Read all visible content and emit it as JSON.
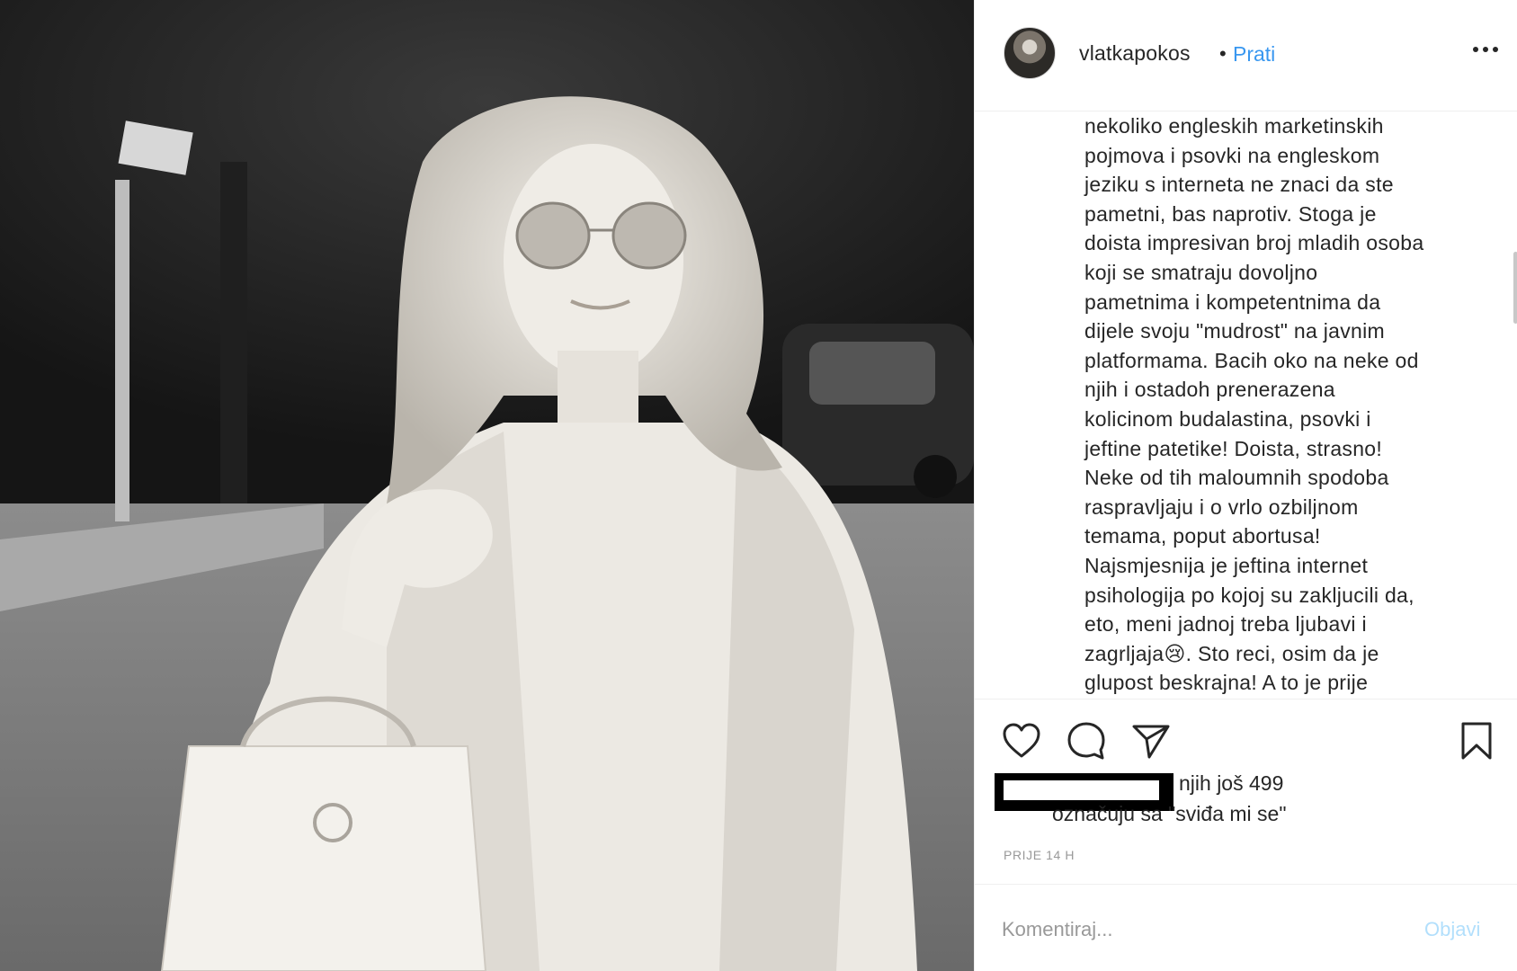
{
  "post": {
    "username": "vlatkapokos",
    "separator": "•",
    "follow_label": "Prati",
    "caption_lines": [
      "nekoliko engleskih marketinskih",
      "pojmova i psovki na engleskom",
      "jeziku s interneta ne znaci da ste",
      "pametni, bas naprotiv. Stoga je",
      "doista impresivan broj mladih osoba",
      "koji se smatraju dovoljno",
      "pametnima i kompetentnima da",
      "dijele svoju \"mudrost\" na javnim",
      "platformama. Bacih oko na neke od",
      "njih i ostadoh prenerazena",
      "kolicinom budalastina, psovki i",
      "jeftine patetike! Doista, strasno!",
      "Neke od tih maloumnih spodoba",
      "raspravljaju i o vrlo ozbiljnom",
      "temama, poput abortusa!",
      "Najsmjesnija je jeftina internet",
      "psihologija po kojoj su zakljucili da,",
      "eto, meni jadnoj treba ljubavi i",
      "zagrljaja😢. Sto reci, osim da je",
      "glupost beskrajna! A to je prije"
    ],
    "likes_line1": "njih još 499",
    "likes_line2": "označuju sa \"sviđa mi se\"",
    "timestamp": "PRIJE 14 H",
    "comment_placeholder": "Komentiraj...",
    "post_button_label": "Objavi"
  },
  "icons": {
    "like": "heart-icon",
    "comment": "comment-icon",
    "share": "share-icon",
    "save": "bookmark-icon",
    "more": "more-options-icon"
  },
  "colors": {
    "link_blue": "#3897f0",
    "post_button_disabled": "#b2dffc",
    "text": "#262626",
    "muted": "#999999"
  }
}
